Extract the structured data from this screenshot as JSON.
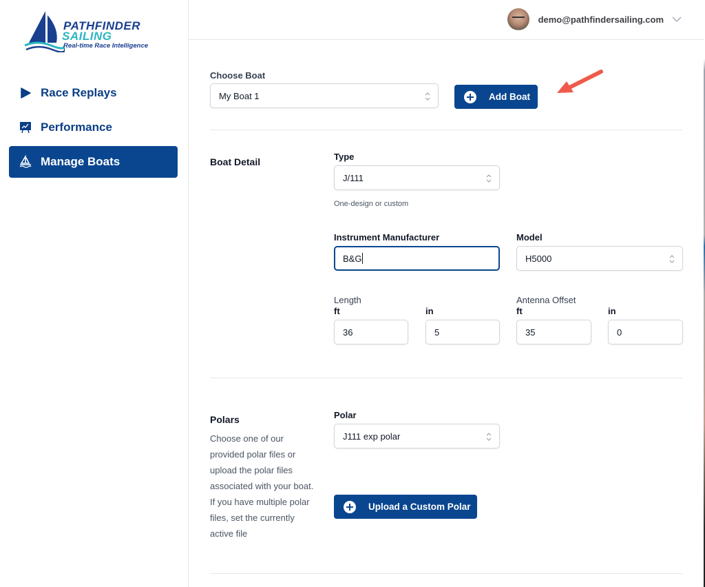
{
  "brand": {
    "line1": "PATHFINDER",
    "line2": "SAILING",
    "tagline": "Real-time Race Intelligence",
    "primary_color": "#0a4690",
    "accent_color": "#2bb5c2"
  },
  "sidebar": {
    "items": [
      {
        "label": "Race Replays",
        "icon": "play-icon",
        "active": false
      },
      {
        "label": "Performance",
        "icon": "presentation-chart-icon",
        "active": false
      },
      {
        "label": "Manage Boats",
        "icon": "sailboat-icon",
        "active": true
      }
    ]
  },
  "header": {
    "user_email": "demo@pathfindersailing.com"
  },
  "choose_boat": {
    "label": "Choose Boat",
    "value": "My Boat 1",
    "add_button": "Add Boat"
  },
  "boat_detail": {
    "section_title": "Boat Detail",
    "type": {
      "label": "Type",
      "value": "J/111",
      "help": "One-design or custom"
    },
    "instrument_manufacturer": {
      "label": "Instrument Manufacturer",
      "value": "B&G"
    },
    "model": {
      "label": "Model",
      "value": "H5000"
    },
    "length": {
      "label": "Length",
      "ft_label": "ft",
      "in_label": "in",
      "ft": "36",
      "in": "5"
    },
    "antenna_offset": {
      "label": "Antenna Offset",
      "ft_label": "ft",
      "in_label": "in",
      "ft": "35",
      "in": "0"
    }
  },
  "polars": {
    "section_title": "Polars",
    "description": "Choose one of our provided polar files or upload the polar files associated with your boat. If you have multiple polar files, set the currently active file",
    "polar": {
      "label": "Polar",
      "value": "J111 exp polar"
    },
    "upload_button": "Upload a Custom Polar"
  },
  "annotation": {
    "color": "#ef5a4a"
  }
}
